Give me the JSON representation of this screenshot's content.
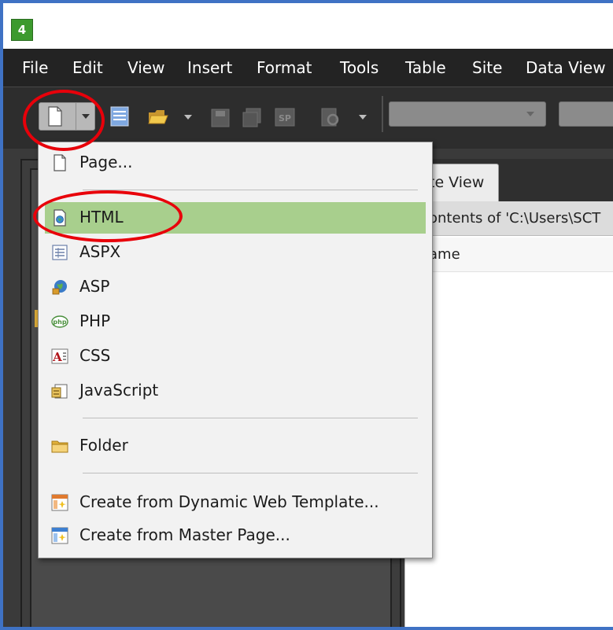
{
  "app": {
    "logo_text": "4"
  },
  "menu": [
    "File",
    "Edit",
    "View",
    "Insert",
    "Format",
    "Tools",
    "Table",
    "Site",
    "Data View"
  ],
  "toolbar": {
    "icons": [
      "new-page-icon",
      "menu-list-icon",
      "open-folder-icon",
      "save-icon",
      "save-all-icon",
      "sharepoint-icon",
      "preview-icon"
    ]
  },
  "new_menu": {
    "items": [
      {
        "label": "Page...",
        "icon": "page-icon"
      },
      {
        "label": "HTML",
        "icon": "html-file-icon",
        "highlighted": true
      },
      {
        "label": "ASPX",
        "icon": "aspx-file-icon"
      },
      {
        "label": "ASP",
        "icon": "asp-file-icon"
      },
      {
        "label": "PHP",
        "icon": "php-file-icon"
      },
      {
        "label": "CSS",
        "icon": "css-file-icon"
      },
      {
        "label": "JavaScript",
        "icon": "javascript-file-icon"
      },
      {
        "label": "Folder",
        "icon": "folder-icon"
      },
      {
        "label": "Create from Dynamic Web Template...",
        "icon": "dynamic-template-icon"
      },
      {
        "label": "Create from Master Page...",
        "icon": "master-page-icon"
      }
    ],
    "highlight_color": "#a8cf8d"
  },
  "site_view": {
    "tab_label": "te View",
    "path_text": "ontents of 'C:\\Users\\SCT",
    "column_header": "ame"
  },
  "annotation": {
    "ring_color": "#e8000a"
  }
}
